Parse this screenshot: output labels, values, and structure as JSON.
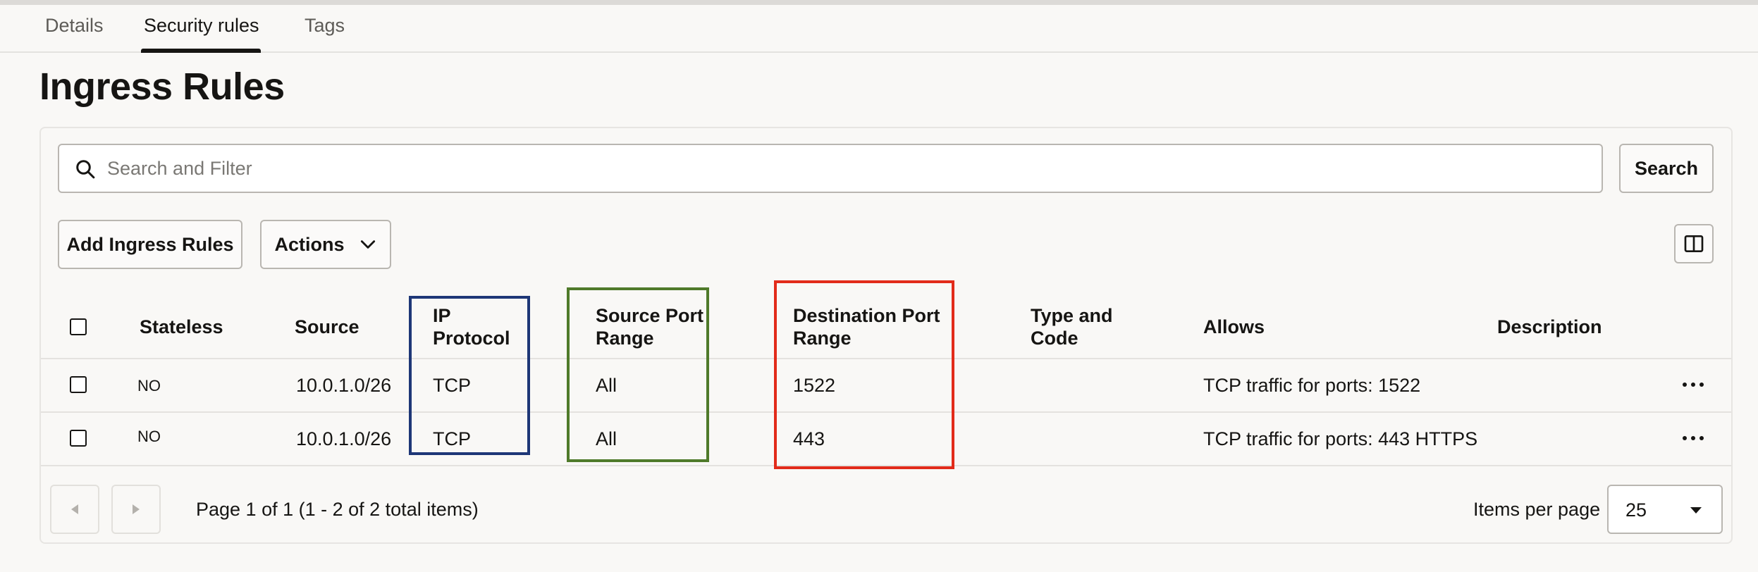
{
  "tabs": [
    {
      "label": "Details"
    },
    {
      "label": "Security rules"
    },
    {
      "label": "Tags"
    }
  ],
  "page_title": "Ingress Rules",
  "search": {
    "placeholder": "Search and Filter",
    "button_label": "Search"
  },
  "toolbar": {
    "add_label": "Add Ingress Rules",
    "actions_label": "Actions"
  },
  "table": {
    "columns": {
      "stateless": "Stateless",
      "source": "Source",
      "ip_protocol_1": "IP",
      "ip_protocol_2": "Protocol",
      "source_port_1": "Source Port",
      "source_port_2": "Range",
      "dest_port_1": "Destination Port",
      "dest_port_2": "Range",
      "type_code_1": "Type and",
      "type_code_2": "Code",
      "allows": "Allows",
      "description": "Description"
    },
    "rows": [
      {
        "stateless": "NO",
        "source": "10.0.1.0/26",
        "ip_protocol": "TCP",
        "source_port": "All",
        "dest_port": "1522",
        "type_code": "",
        "allows": "TCP traffic for ports: 1522",
        "description": ""
      },
      {
        "stateless": "NO",
        "source": "10.0.1.0/26",
        "ip_protocol": "TCP",
        "source_port": "All",
        "dest_port": "443",
        "type_code": "",
        "allows": "TCP traffic for ports: 443 HTTPS",
        "description": ""
      }
    ]
  },
  "pagination": {
    "info": "Page 1 of 1 (1 - 2 of 2 total items)",
    "items_per_page_label": "Items per page",
    "items_per_page_value": "25"
  },
  "highlight_colors": {
    "ip_protocol": "#1e3777",
    "source_port_range": "#4f7a2a",
    "destination_port_range": "#e22b1a"
  }
}
